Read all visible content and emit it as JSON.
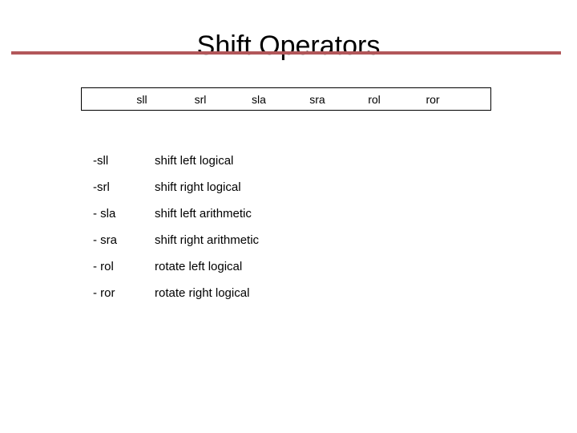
{
  "slide": {
    "title": "Shift Operators",
    "rule_color": "#b2575a",
    "background_color": "#ffffff",
    "text_color": "#000000"
  },
  "table": {
    "border_color": "#000000",
    "headers": [
      "sll",
      "srl",
      "sla",
      "sra",
      "rol",
      "ror"
    ]
  },
  "operations": [
    {
      "mnemonic": "-sll",
      "description": "shift left logical"
    },
    {
      "mnemonic": "-srl",
      "description": "shift right logical"
    },
    {
      "mnemonic": "- sla",
      "description": "shift left arithmetic"
    },
    {
      "mnemonic": "- sra",
      "description": "shift right arithmetic"
    },
    {
      "mnemonic": "- rol",
      "description": "rotate left logical"
    },
    {
      "mnemonic": "- ror",
      "description": "rotate right logical"
    }
  ]
}
